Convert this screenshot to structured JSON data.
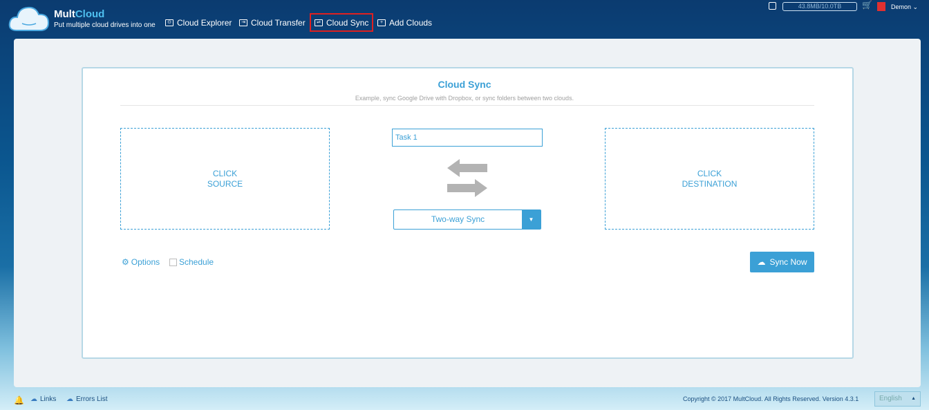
{
  "header": {
    "brand_a": "Mult",
    "brand_b": "Cloud",
    "tagline": "Put multiple cloud drives into one",
    "nav": [
      {
        "label": "Cloud Explorer",
        "icon": "⊙"
      },
      {
        "label": "Cloud Transfer",
        "icon": "⇥"
      },
      {
        "label": "Cloud Sync",
        "icon": "⇌"
      },
      {
        "label": "Add Clouds",
        "icon": "+"
      }
    ],
    "usage": "43.8MB/10.0TB",
    "user": "Demon"
  },
  "main": {
    "title": "Cloud Sync",
    "subtitle": "Example, sync Google Drive with Dropbox, or sync folders between two clouds.",
    "source_line1": "CLICK",
    "source_line2": "SOURCE",
    "dest_line1": "CLICK",
    "dest_line2": "DESTINATION",
    "task_name": "Task 1",
    "sync_mode": "Two-way Sync",
    "options": "Options",
    "schedule": "Schedule",
    "sync_now": "Sync Now"
  },
  "footer": {
    "links": "Links",
    "errors": "Errors List",
    "copyright": "Copyright © 2017 MultCloud. All Rights Reserved. Version 4.3.1",
    "language": "English"
  }
}
